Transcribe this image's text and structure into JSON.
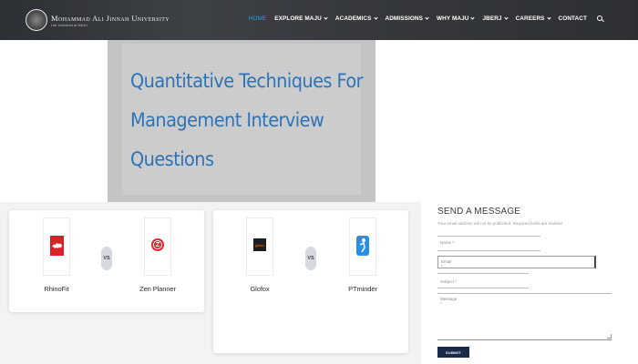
{
  "header": {
    "logo_name": "Mohammad Ali Jinnah University",
    "logo_tagline": "Life Unlimited at MAJU",
    "nav": [
      {
        "label": "HOME",
        "active": true,
        "dropdown": false
      },
      {
        "label": "EXPLORE MAJU",
        "active": false,
        "dropdown": true
      },
      {
        "label": "ACADEMICS",
        "active": false,
        "dropdown": true
      },
      {
        "label": "ADMISSIONS",
        "active": false,
        "dropdown": true
      },
      {
        "label": "WHY MAJU",
        "active": false,
        "dropdown": true
      },
      {
        "label": "JBERJ",
        "active": false,
        "dropdown": true
      },
      {
        "label": "CAREERS",
        "active": false,
        "dropdown": true
      },
      {
        "label": "CONTACT",
        "active": false,
        "dropdown": false
      }
    ],
    "active_color": "#27a3e0",
    "search_icon": "search-icon"
  },
  "hero": {
    "title_lines": [
      "Quantitative Techniques For",
      "Management Interview",
      "Questions"
    ],
    "title_color": "#2d73b8"
  },
  "comparisons": [
    {
      "left": {
        "name": "RhinoFit",
        "icon": "rhino-icon",
        "color": "#d8222a"
      },
      "vs": "VS",
      "right": {
        "name": "Zen Planner",
        "icon": "zen-planner-icon",
        "color": "#e3262b"
      }
    },
    {
      "left": {
        "name": "Glofox",
        "icon": "glofox-icon",
        "color": "#1e1e1e",
        "icon_text": "glofox"
      },
      "vs": "VS",
      "right": {
        "name": "PTminder",
        "icon": "ptminder-icon",
        "color": "#2b8ee6"
      }
    }
  ],
  "contact_form": {
    "title": "SEND A MESSAGE",
    "note": "Your email address will not be published. Required fields are marked",
    "name_placeholder": "Name *",
    "email_placeholder": "Email *",
    "subject_placeholder": "Subject *",
    "message_placeholder": "Message *",
    "submit_label": "SUBMIT",
    "submit_color": "#1b2a4a"
  }
}
